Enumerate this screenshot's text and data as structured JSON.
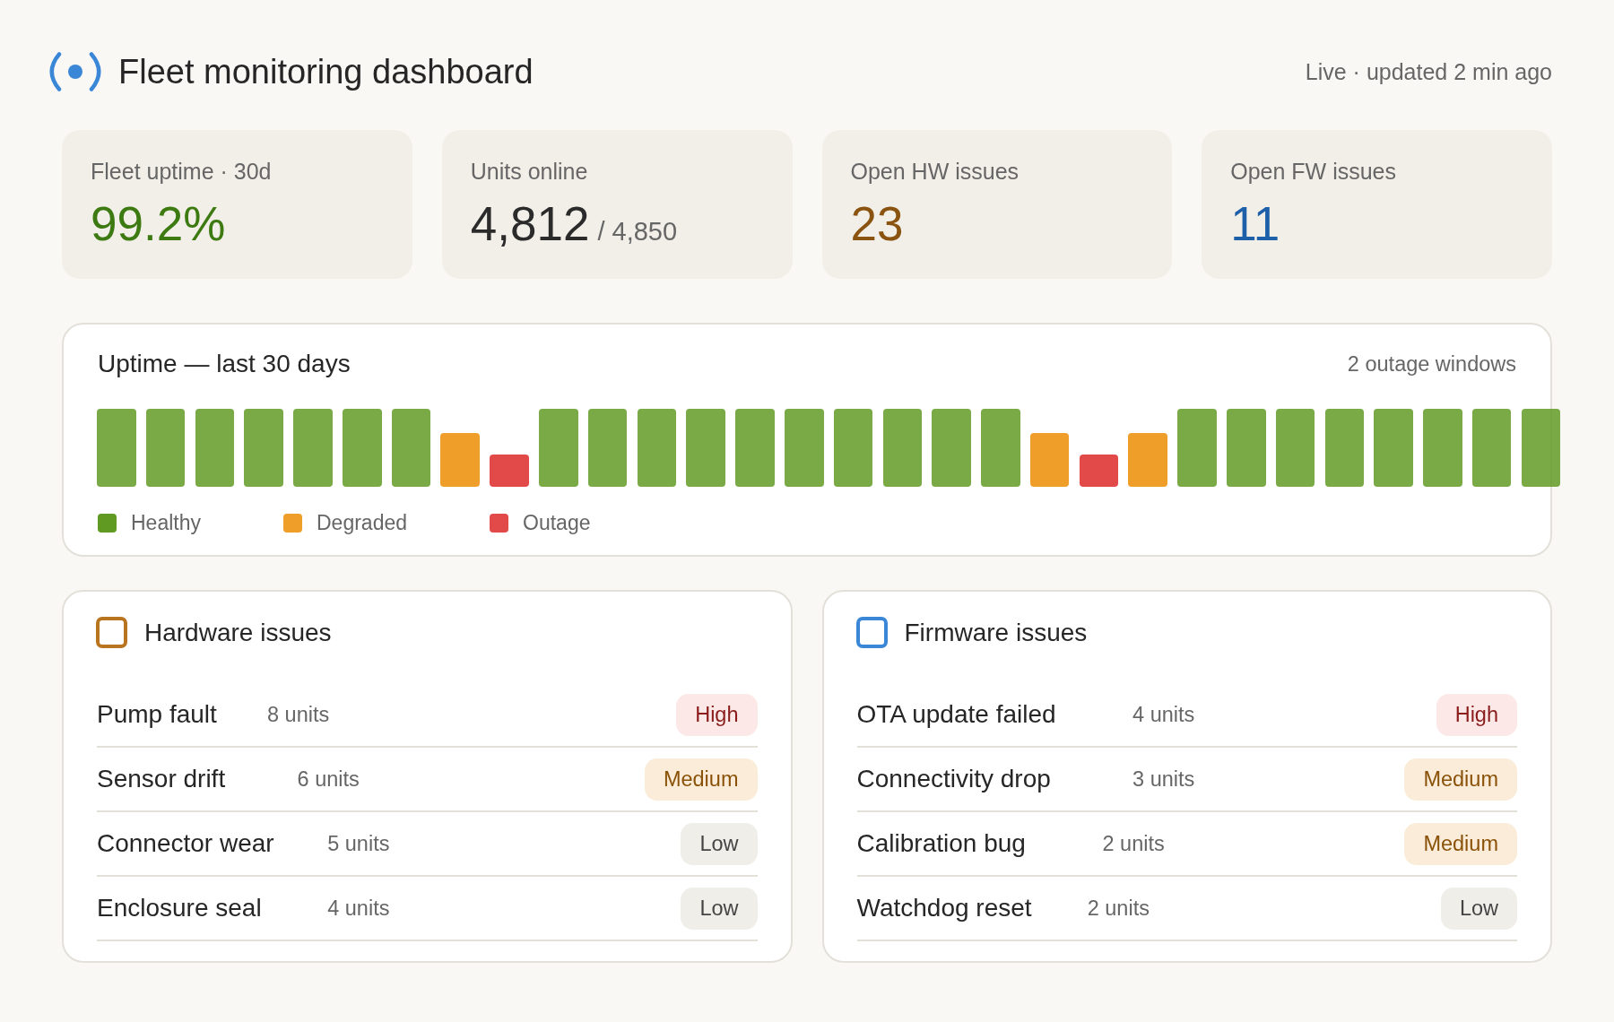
{
  "header": {
    "title": "Fleet monitoring dashboard",
    "status": "Live · updated 2 min ago"
  },
  "stats": [
    {
      "label": "Fleet uptime · 30d",
      "value": "99.2%",
      "color": "#3d7a12"
    },
    {
      "label": "Units online",
      "value": "4,812",
      "suffix": "/ 4,850",
      "color": "#2b2b2b"
    },
    {
      "label": "Open HW issues",
      "value": "23",
      "color": "#8a5410"
    },
    {
      "label": "Open FW issues",
      "value": "11",
      "color": "#1d5fa8"
    }
  ],
  "uptime": {
    "title": "Uptime — last 30 days",
    "summary": "2 outage windows",
    "days": [
      {
        "kind": "healthy"
      },
      {
        "kind": "healthy"
      },
      {
        "kind": "healthy"
      },
      {
        "kind": "healthy"
      },
      {
        "kind": "healthy"
      },
      {
        "kind": "healthy"
      },
      {
        "kind": "healthy"
      },
      {
        "kind": "degraded"
      },
      {
        "kind": "outage"
      },
      {
        "kind": "healthy"
      },
      {
        "kind": "healthy"
      },
      {
        "kind": "healthy"
      },
      {
        "kind": "healthy"
      },
      {
        "kind": "healthy"
      },
      {
        "kind": "healthy"
      },
      {
        "kind": "healthy"
      },
      {
        "kind": "healthy"
      },
      {
        "kind": "healthy"
      },
      {
        "kind": "healthy"
      },
      {
        "kind": "degraded"
      },
      {
        "kind": "outage"
      },
      {
        "kind": "degraded"
      },
      {
        "kind": "healthy"
      },
      {
        "kind": "healthy"
      },
      {
        "kind": "healthy"
      },
      {
        "kind": "healthy"
      },
      {
        "kind": "healthy"
      },
      {
        "kind": "healthy"
      },
      {
        "kind": "healthy"
      },
      {
        "kind": "healthy"
      }
    ],
    "legend": [
      {
        "kind": "healthy",
        "label": "Healthy",
        "color": "#609a23"
      },
      {
        "kind": "degraded",
        "label": "Degraded",
        "color": "#ef9f29"
      },
      {
        "kind": "outage",
        "label": "Outage",
        "color": "#e24a4a"
      }
    ]
  },
  "issue_panels": [
    {
      "title": "Hardware issues",
      "color": "#b8741f",
      "issues": [
        {
          "name": "Pump fault",
          "units": "8 units",
          "badge": {
            "text": "High",
            "kind": "high"
          }
        },
        {
          "name": "Sensor drift",
          "units": "6 units",
          "badge": {
            "text": "Medium",
            "kind": "medium"
          }
        },
        {
          "name": "Connector wear",
          "units": "5 units",
          "badge": {
            "text": "Low",
            "kind": "low"
          }
        },
        {
          "name": "Enclosure seal",
          "units": "4 units",
          "badge": {
            "text": "Low",
            "kind": "low"
          }
        }
      ]
    },
    {
      "title": "Firmware issues",
      "color": "#3a87d8",
      "issues": [
        {
          "name": "OTA update failed",
          "units": "4 units",
          "badge": {
            "text": "High",
            "kind": "high"
          }
        },
        {
          "name": "Connectivity drop",
          "units": "3 units",
          "badge": {
            "text": "Medium",
            "kind": "medium"
          }
        },
        {
          "name": "Calibration bug",
          "units": "2 units",
          "badge": {
            "text": "Medium",
            "kind": "medium"
          }
        },
        {
          "name": "Watchdog reset",
          "units": "2 units",
          "badge": {
            "text": "Low",
            "kind": "low"
          }
        }
      ]
    }
  ]
}
